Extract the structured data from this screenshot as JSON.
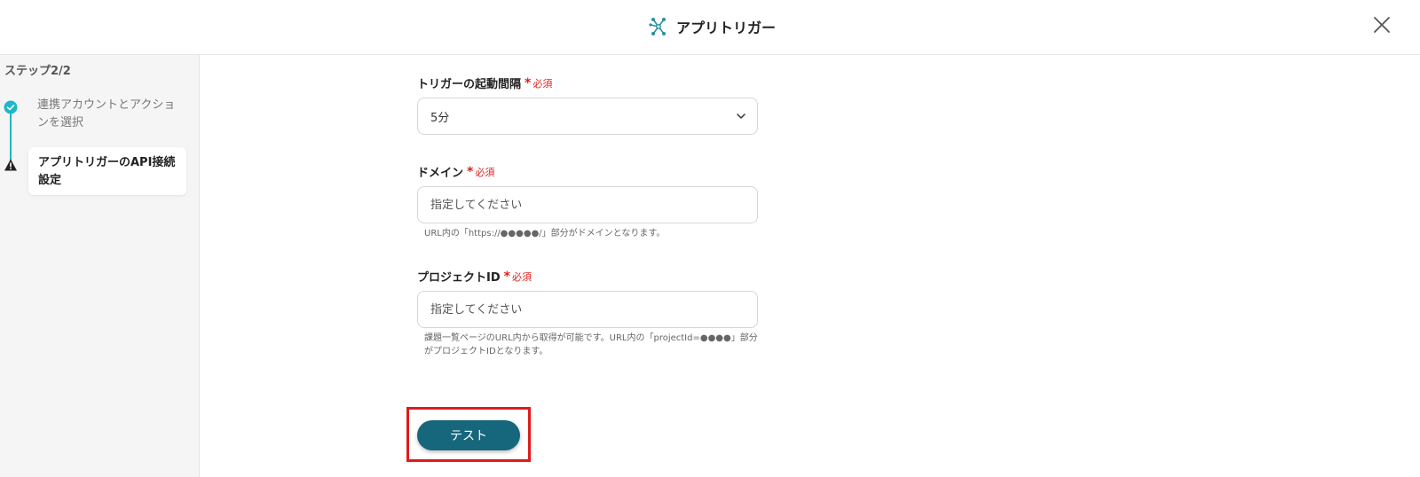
{
  "header": {
    "title": "アプリトリガー",
    "icon": "app-trigger-icon",
    "close_icon": "close-icon"
  },
  "sidebar": {
    "step_title": "ステップ2/2",
    "steps": [
      {
        "label": "連携アカウントとアクションを選択",
        "status": "completed",
        "icon": "check-circle-icon"
      },
      {
        "label": "アプリトリガーのAPI接続設定",
        "status": "current",
        "icon": "warning-icon"
      }
    ]
  },
  "form": {
    "interval": {
      "label": "トリガーの起動間隔",
      "required_mark": "*",
      "required_text": "必須",
      "value": "5分"
    },
    "domain": {
      "label": "ドメイン",
      "required_mark": "*",
      "required_text": "必須",
      "value": "",
      "placeholder": "指定してください",
      "help": "URL内の「https://●●●●●/」部分がドメインとなります。"
    },
    "project_id": {
      "label": "プロジェクトID",
      "required_mark": "*",
      "required_text": "必須",
      "value": "",
      "placeholder": "指定してください",
      "help": "課題一覧ページのURL内から取得が可能です。URL内の「projectId=●●●●」部分がプロジェクトIDとなります。"
    }
  },
  "test_button": {
    "label": "テスト"
  },
  "colors": {
    "accent": "#16667c",
    "step_done": "#1fb6c8",
    "required": "#e02020",
    "highlight": "#e01b1b"
  }
}
